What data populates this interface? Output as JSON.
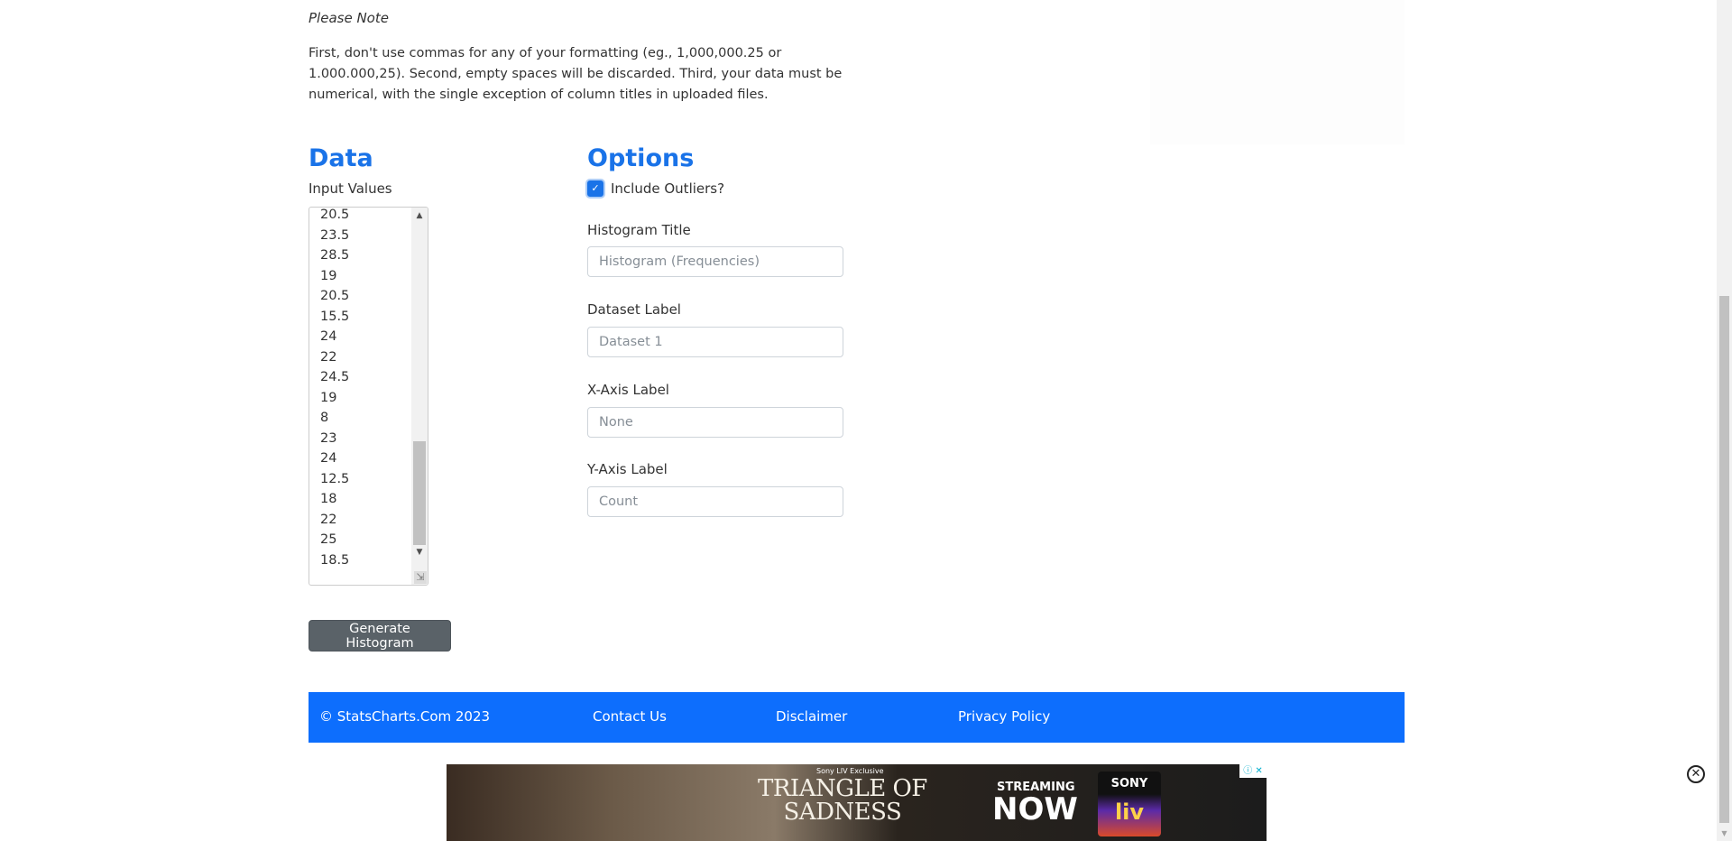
{
  "note": {
    "title": "Please Note",
    "body": "First, don't use commas for any of your formatting (eg., 1,000,000.25 or 1.000.000,25). Second, empty spaces will be discarded. Third, your data must be numerical, with the single exception of column titles in uploaded files."
  },
  "data_section": {
    "title": "Data",
    "input_label": "Input Values",
    "values": [
      "20.5",
      "23.5",
      "28.5",
      "19",
      "20.5",
      "15.5",
      "24",
      "22",
      "24.5",
      "19",
      "8",
      "23",
      "24",
      "12.5",
      "18",
      "22",
      "25",
      "18.5"
    ]
  },
  "options_section": {
    "title": "Options",
    "include_outliers_label": "Include Outliers?",
    "include_outliers_checked": true,
    "histogram_title_label": "Histogram Title",
    "histogram_title_placeholder": "Histogram (Frequencies)",
    "dataset_label_label": "Dataset Label",
    "dataset_label_placeholder": "Dataset 1",
    "x_axis_label_label": "X-Axis Label",
    "x_axis_label_placeholder": "None",
    "y_axis_label_label": "Y-Axis Label",
    "y_axis_label_placeholder": "Count"
  },
  "generate_button_label": "Generate Histogram",
  "footer": {
    "copyright": "© StatsCharts.Com 2023",
    "contact": "Contact Us",
    "disclaimer": "Disclaimer",
    "privacy": "Privacy Policy",
    "background_color": "#0d6efd"
  },
  "ad": {
    "exclusive": "Sony LIV Exclusive",
    "film_line1": "TRIANGLE OF",
    "film_line2": "SADNESS",
    "streaming": "STREAMING",
    "now": "NOW",
    "sony": "SONY",
    "liv": "liv"
  },
  "colors": {
    "accent": "#1a73e8",
    "button": "#5a6268"
  },
  "icons": {
    "ad_info": "info-icon",
    "ad_close": "close-icon",
    "float_close": "close-circle-icon"
  }
}
